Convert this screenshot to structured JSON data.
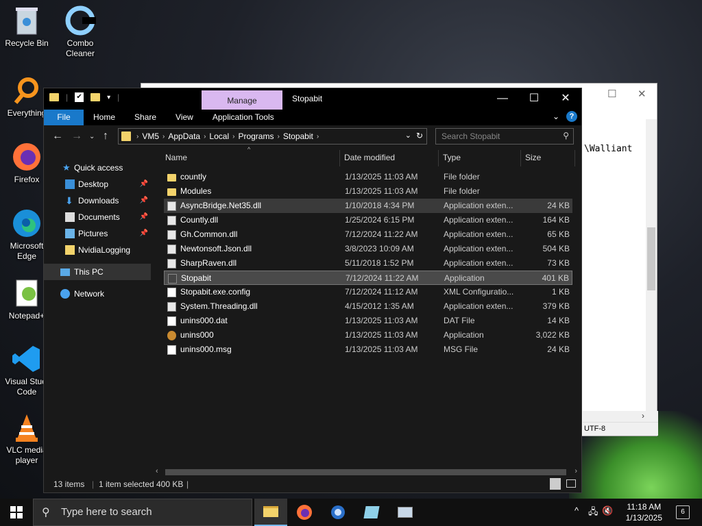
{
  "desktop": {
    "icons": [
      {
        "label": "Recycle Bin"
      },
      {
        "label": "Combo Cleaner"
      },
      {
        "label": "Everything"
      },
      {
        "label": "Firefox"
      },
      {
        "label": "Microsoft Edge"
      },
      {
        "label": "Notepad+"
      },
      {
        "label": "Visual Studi Code"
      },
      {
        "label": "VLC media player"
      }
    ]
  },
  "notepad": {
    "text": "\\Walliant",
    "status": "UTF-8"
  },
  "explorer": {
    "manage_tab": "Manage",
    "title": "Stopabit",
    "ribbon": {
      "file": "File",
      "home": "Home",
      "share": "Share",
      "view": "View",
      "app_tools": "Application Tools"
    },
    "address": [
      "VM5",
      "AppData",
      "Local",
      "Programs",
      "Stopabit"
    ],
    "search_placeholder": "Search Stopabit",
    "sidebar": [
      {
        "label": "Quick access"
      },
      {
        "label": "Desktop"
      },
      {
        "label": "Downloads"
      },
      {
        "label": "Documents"
      },
      {
        "label": "Pictures"
      },
      {
        "label": "NvidiaLogging"
      },
      {
        "label": "This PC"
      },
      {
        "label": "Network"
      }
    ],
    "columns": {
      "name": "Name",
      "date": "Date modified",
      "type": "Type",
      "size": "Size"
    },
    "files": [
      {
        "name": "countly",
        "date": "1/13/2025 11:03 AM",
        "type": "File folder",
        "size": "",
        "icon": "folder"
      },
      {
        "name": "Modules",
        "date": "1/13/2025 11:03 AM",
        "type": "File folder",
        "size": "",
        "icon": "folder"
      },
      {
        "name": "AsyncBridge.Net35.dll",
        "date": "1/10/2018 4:34 PM",
        "type": "Application exten...",
        "size": "24 KB",
        "icon": "dll"
      },
      {
        "name": "Countly.dll",
        "date": "1/25/2024 6:15 PM",
        "type": "Application exten...",
        "size": "164 KB",
        "icon": "dll"
      },
      {
        "name": "Gh.Common.dll",
        "date": "7/12/2024 11:22 AM",
        "type": "Application exten...",
        "size": "65 KB",
        "icon": "dll"
      },
      {
        "name": "Newtonsoft.Json.dll",
        "date": "3/8/2023 10:09 AM",
        "type": "Application exten...",
        "size": "504 KB",
        "icon": "dll"
      },
      {
        "name": "SharpRaven.dll",
        "date": "5/11/2018 1:52 PM",
        "type": "Application exten...",
        "size": "73 KB",
        "icon": "dll"
      },
      {
        "name": "Stopabit",
        "date": "7/12/2024 11:22 AM",
        "type": "Application",
        "size": "401 KB",
        "icon": "app"
      },
      {
        "name": "Stopabit.exe.config",
        "date": "7/12/2024 11:12 AM",
        "type": "XML Configuratio...",
        "size": "1 KB",
        "icon": "file"
      },
      {
        "name": "System.Threading.dll",
        "date": "4/15/2012 1:35 AM",
        "type": "Application exten...",
        "size": "379 KB",
        "icon": "dll"
      },
      {
        "name": "unins000.dat",
        "date": "1/13/2025 11:03 AM",
        "type": "DAT File",
        "size": "14 KB",
        "icon": "file"
      },
      {
        "name": "unins000",
        "date": "1/13/2025 11:03 AM",
        "type": "Application",
        "size": "3,022 KB",
        "icon": "exe"
      },
      {
        "name": "unins000.msg",
        "date": "1/13/2025 11:03 AM",
        "type": "MSG File",
        "size": "24 KB",
        "icon": "file"
      }
    ],
    "status": {
      "items": "13 items",
      "selected": "1 item selected",
      "size": "400 KB"
    }
  },
  "taskbar": {
    "search_placeholder": "Type here to search",
    "time": "11:18 AM",
    "date": "1/13/2025",
    "notifications": "6"
  }
}
